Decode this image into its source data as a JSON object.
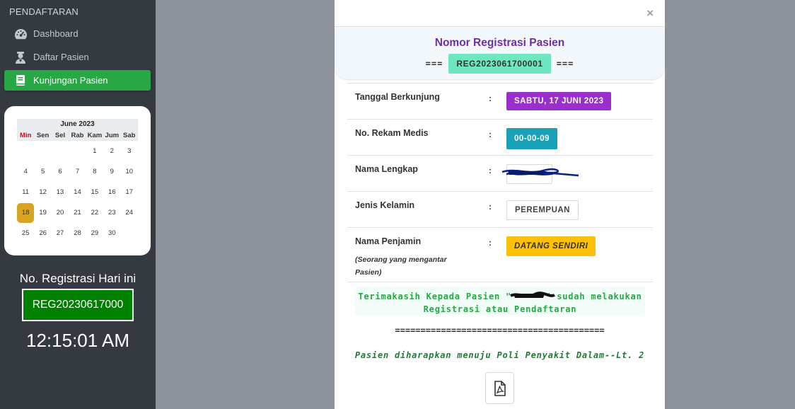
{
  "sidebar": {
    "header": "PENDAFTARAN",
    "items": [
      {
        "label": "Dashboard",
        "icon": "dashboard-icon"
      },
      {
        "label": "Daftar Pasien",
        "icon": "user-icon"
      },
      {
        "label": "Kunjungan Pasien",
        "icon": "book-icon",
        "active": true
      }
    ],
    "calendar": {
      "title": "June 2023",
      "days": [
        "Min",
        "Sen",
        "Sel",
        "Rab",
        "Kam",
        "Jum",
        "Sab"
      ],
      "weeks": [
        [
          "",
          "",
          "",
          "",
          "1",
          "2",
          "3"
        ],
        [
          "4",
          "5",
          "6",
          "7",
          "8",
          "9",
          "10"
        ],
        [
          "11",
          "12",
          "13",
          "14",
          "15",
          "16",
          "17"
        ],
        [
          "18",
          "19",
          "20",
          "21",
          "22",
          "23",
          "24"
        ],
        [
          "25",
          "26",
          "27",
          "28",
          "29",
          "30",
          ""
        ]
      ],
      "today": "18"
    },
    "reg_label": "No. Registrasi Hari ini",
    "reg_value": "REG20230617000",
    "clock": "12:15:01 AM"
  },
  "modal": {
    "close": "×",
    "title": "Nomor Registrasi Pasien",
    "eq_left": "===",
    "eq_right": "===",
    "reg_no": "REG2023061700001",
    "colon": ":",
    "rows": [
      {
        "label": "Tanggal Berkunjung",
        "value": "SABTU, 17 JUNI 2023"
      },
      {
        "label": "No. Rekam Medis",
        "value": "00-00-09"
      },
      {
        "label": "Nama Lengkap",
        "value": ""
      },
      {
        "label": "Jenis Kelamin",
        "value": "PEREMPUAN"
      },
      {
        "label": "Nama Penjamin",
        "sub": "(Seorang yang mengantar Pasien)",
        "value": "DATANG SENDIRI"
      }
    ],
    "thanks_line1": "Terimakasih Kepada Pasien \"      \" sudah melakukan",
    "thanks_line2": "Registrasi atau Pendaftaran",
    "separator": "=========================================",
    "poli": "Pasien diharapkan menuju Poli Penyakit Dalam--Lt. 2",
    "pdf_icon": "pdf-file-icon"
  },
  "colors": {
    "sidebar_bg": "#343a40",
    "active_green": "#28a745",
    "title_purple": "#6f2da8",
    "reg_badge": "#6ee7c1",
    "date_badge": "#9b2fc9",
    "rm_badge": "#17a2b8",
    "penjamin_badge": "#ffc107",
    "today_highlight": "#d9a520",
    "reg_today_green": "#008000"
  }
}
